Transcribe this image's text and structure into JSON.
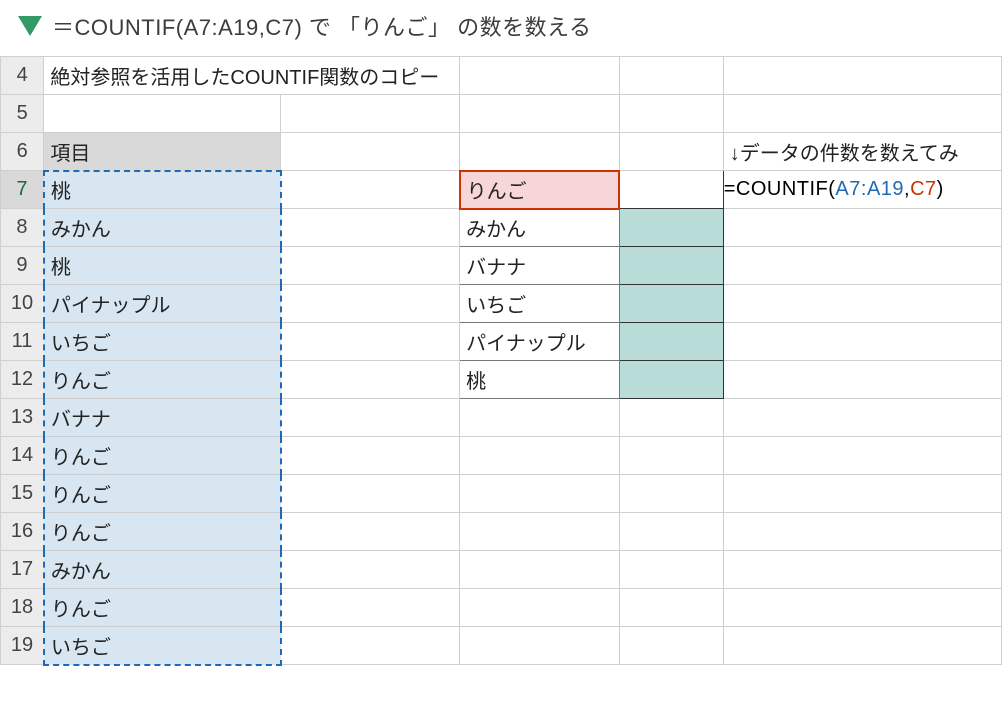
{
  "title": "＝COUNTIF(A7:A19,C7) で 「りんご」 の数を数える",
  "rows": {
    "r4": {
      "a": "絶対参照を活用したCOUNTIF関数のコピー"
    },
    "r5": {},
    "r6": {
      "a": "項目",
      "e": "↓データの件数を数えてみ"
    },
    "r7": {
      "a": "桃",
      "c": "りんご"
    },
    "r8": {
      "a": "みかん",
      "c": "みかん"
    },
    "r9": {
      "a": "桃",
      "c": "バナナ"
    },
    "r10": {
      "a": "パイナップル",
      "c": "いちご"
    },
    "r11": {
      "a": "いちご",
      "c": "パイナップル"
    },
    "r12": {
      "a": "りんご",
      "c": "桃"
    },
    "r13": {
      "a": "バナナ"
    },
    "r14": {
      "a": "りんご"
    },
    "r15": {
      "a": "りんご"
    },
    "r16": {
      "a": "りんご"
    },
    "r17": {
      "a": "みかん"
    },
    "r18": {
      "a": "りんご"
    },
    "r19": {
      "a": "いちご"
    }
  },
  "rowNumbers": [
    "4",
    "5",
    "6",
    "7",
    "8",
    "9",
    "10",
    "11",
    "12",
    "13",
    "14",
    "15",
    "16",
    "17",
    "18",
    "19"
  ],
  "formula": {
    "prefix": "=COUNTIF(",
    "range": "A7:A19",
    "comma": ",",
    "criteria": "C7",
    "suffix": ")"
  }
}
